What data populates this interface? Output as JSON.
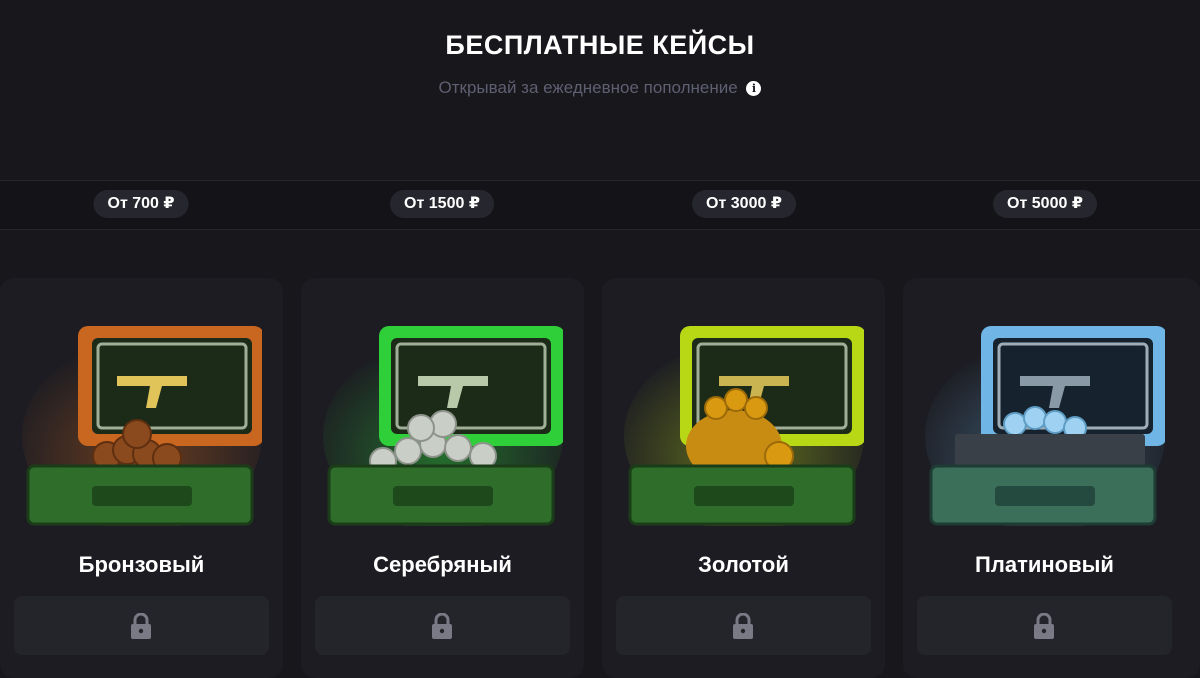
{
  "header": {
    "title": "БЕСПЛАТНЫЕ КЕЙСЫ",
    "subtitle": "Открывай за ежедневное пополнение",
    "info_icon": "info-icon"
  },
  "cases": [
    {
      "price_label": "От 700 ₽",
      "name": "Бронзовый",
      "locked": true,
      "accent": "#c9661f",
      "coin_color": "#8a4a1e"
    },
    {
      "price_label": "От 1500 ₽",
      "name": "Серебряный",
      "locked": true,
      "accent": "#2fcf3a",
      "coin_color": "#c9cfc7"
    },
    {
      "price_label": "От 3000 ₽",
      "name": "Золотой",
      "locked": true,
      "accent": "#b8d816",
      "coin_color": "#d99a12"
    },
    {
      "price_label": "От 5000 ₽",
      "name": "Платиновый",
      "locked": true,
      "accent": "#6fb6e6",
      "coin_color": "#9fd2f2"
    }
  ],
  "icons": {
    "lock": "lock-icon"
  },
  "colors": {
    "background": "#17171c",
    "card": "#1c1c22",
    "pill": "#26262e",
    "subtitle": "#5f5f72"
  }
}
